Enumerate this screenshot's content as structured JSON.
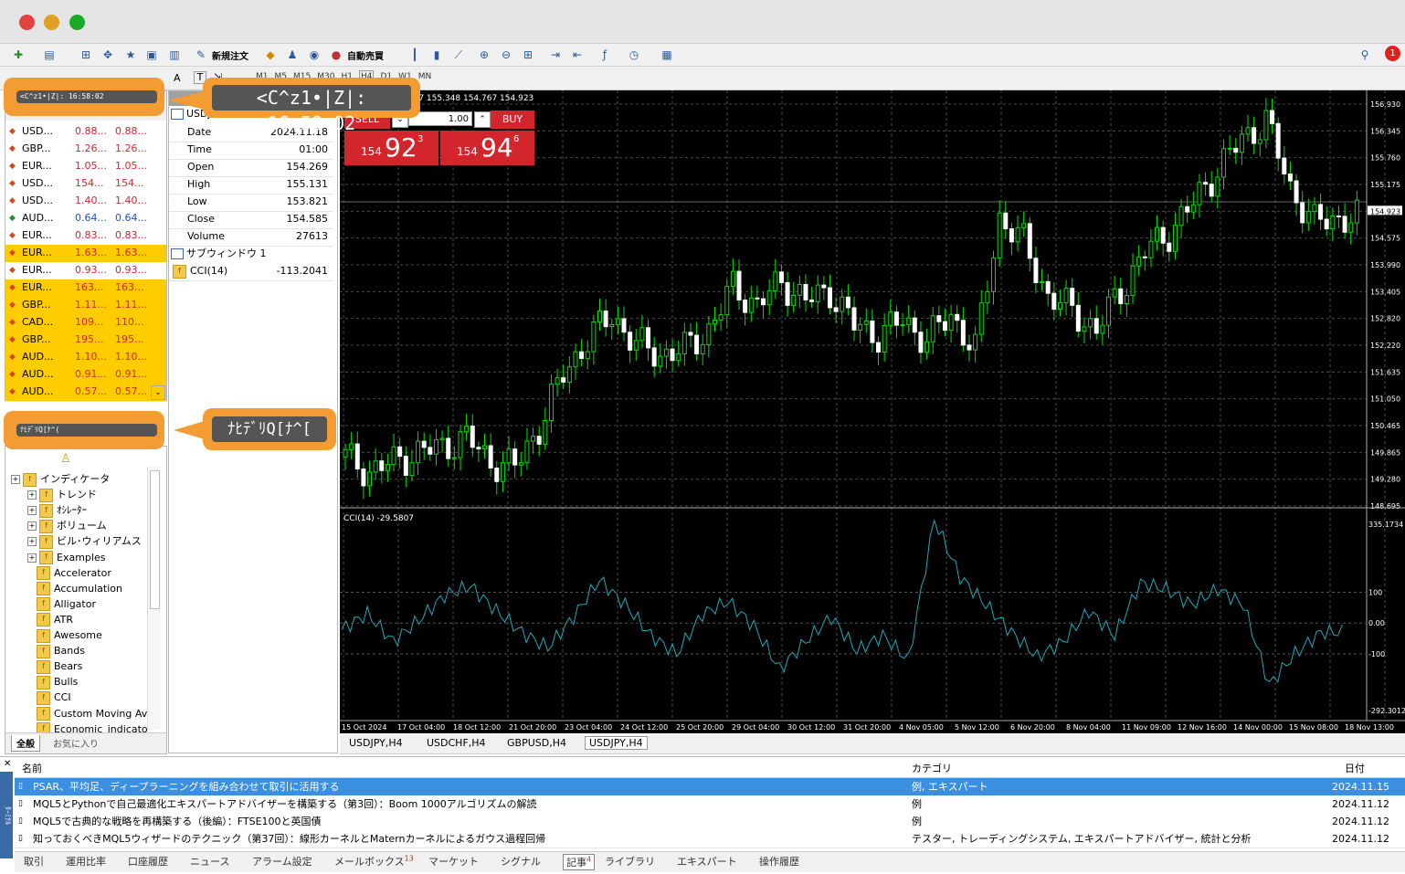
{
  "toolbar": {
    "new_order": "新規注文",
    "auto_trade": "自動売買"
  },
  "timeframes": [
    "M1",
    "M5",
    "M15",
    "M30",
    "H1",
    "H4",
    "D1",
    "W1",
    "MN"
  ],
  "market_watch": {
    "time_label": "<C^z1•|Z|: 16:58:02",
    "rows": [
      {
        "symbol": "USD...",
        "bid": "0.88...",
        "ask": "0.88...",
        "hl": false
      },
      {
        "symbol": "GBP...",
        "bid": "1.26...",
        "ask": "1.26...",
        "hl": false
      },
      {
        "symbol": "EUR...",
        "bid": "1.05...",
        "ask": "1.05...",
        "hl": false
      },
      {
        "symbol": "USD...",
        "bid": "154...",
        "ask": "154...",
        "hl": false
      },
      {
        "symbol": "USD...",
        "bid": "1.40...",
        "ask": "1.40...",
        "hl": false
      },
      {
        "symbol": "AUD...",
        "bid": "0.64...",
        "ask": "0.64...",
        "hl": false,
        "blue": true
      },
      {
        "symbol": "EUR...",
        "bid": "0.83...",
        "ask": "0.83...",
        "hl": false
      },
      {
        "symbol": "EUR...",
        "bid": "1.63...",
        "ask": "1.63...",
        "hl": true
      },
      {
        "symbol": "EUR...",
        "bid": "0.93...",
        "ask": "0.93...",
        "hl": false
      },
      {
        "symbol": "EUR...",
        "bid": "163...",
        "ask": "163...",
        "hl": true
      },
      {
        "symbol": "GBP...",
        "bid": "1.11...",
        "ask": "1.11...",
        "hl": true
      },
      {
        "symbol": "CAD...",
        "bid": "109...",
        "ask": "110...",
        "hl": true
      },
      {
        "symbol": "GBP...",
        "bid": "195...",
        "ask": "195...",
        "hl": true
      },
      {
        "symbol": "AUD...",
        "bid": "1.10...",
        "ask": "1.10...",
        "hl": true
      },
      {
        "symbol": "AUD...",
        "bid": "0.91...",
        "ask": "0.91...",
        "hl": true
      },
      {
        "symbol": "AUD...",
        "bid": "0.57...",
        "ask": "0.57...",
        "hl": true
      }
    ]
  },
  "callouts": {
    "top": "<C^z1•|Z|: 16:58:02",
    "mid": "ﾅﾋﾃﾞﾘQ[ﾅ^["
  },
  "navigator": {
    "title": "ﾅﾋﾃﾞﾘQ[ﾅ^(",
    "items": [
      "インディケータ",
      "トレンド",
      "ｵｼﾚｰﾀｰ",
      "ボリューム",
      "ビル･ウィリアムス",
      "Examples",
      "Accelerator",
      "Accumulation",
      "Alligator",
      "ATR",
      "Awesome",
      "Bands",
      "Bears",
      "Bulls",
      "CCI",
      "Custom Moving Av",
      "Economic_indicato"
    ],
    "tabs": [
      "全般",
      "お気に入り"
    ]
  },
  "data_window": {
    "symbol": "USDJPY,H4",
    "rows": [
      {
        "label": "Date",
        "value": "2024.11.18"
      },
      {
        "label": "Time",
        "value": "01:00"
      },
      {
        "label": "Open",
        "value": "154.269"
      },
      {
        "label": "High",
        "value": "155.131"
      },
      {
        "label": "Low",
        "value": "153.821"
      },
      {
        "label": "Close",
        "value": "154.585"
      },
      {
        "label": "Volume",
        "value": "27613"
      }
    ],
    "subwindow": "サブウィンドウ 1",
    "cci_label": "CCI(14)",
    "cci_value": "-113.2041"
  },
  "chart": {
    "header": "USDJPY,H4  154.767 155.348 154.767 154.923",
    "sell": "SELL",
    "buy": "BUY",
    "lot": "1.00",
    "sell_price": {
      "small": "154",
      "big": "92",
      "sup": "3"
    },
    "buy_price": {
      "small": "154",
      "big": "94",
      "sup": "6"
    },
    "price_labels": [
      "156.930",
      "156.345",
      "155.760",
      "155.175",
      "154.923",
      "154.575",
      "153.990",
      "153.405",
      "152.820",
      "152.220",
      "151.635",
      "151.050",
      "150.465",
      "149.865",
      "149.280",
      "148.695"
    ],
    "cci_header": "CCI(14) -29.5807",
    "cci_labels": [
      "335.1734",
      "100",
      "0.00",
      "-100",
      "-292.3012"
    ],
    "time_labels": [
      "15 Oct 2024",
      "17 Oct 04:00",
      "18 Oct 12:00",
      "21 Oct 20:00",
      "23 Oct 04:00",
      "24 Oct 12:00",
      "25 Oct 20:00",
      "29 Oct 04:00",
      "30 Oct 12:00",
      "31 Oct 20:00",
      "4 Nov 05:00",
      "5 Nov 12:00",
      "6 Nov 20:00",
      "8 Nov 04:00",
      "11 Nov 09:00",
      "12 Nov 16:00",
      "14 Nov 00:00",
      "15 Nov 08:00",
      "18 Nov 13:00"
    ],
    "tabs": [
      "USDJPY,H4",
      "USDCHF,H4",
      "GBPUSD,H4",
      "USDJPY,H4"
    ]
  },
  "chart_data": {
    "type": "line",
    "title": "USDJPY,H4",
    "ylim": [
      148.695,
      156.93
    ],
    "close_approx": [
      149.7,
      149.4,
      149.6,
      149.8,
      149.9,
      150.1,
      149.6,
      149.5,
      150.3,
      151.4,
      152.1,
      152.6,
      152.0,
      151.8,
      151.9,
      152.3,
      153.2,
      152.8,
      153.3,
      152.9,
      153.1,
      152.4,
      152.2,
      152.5,
      152.1,
      152.6,
      151.9,
      154.6,
      154.1,
      153.0,
      152.7,
      152.3,
      153.1,
      153.9,
      154.3,
      154.9,
      155.6,
      156.2,
      156.6,
      155.2,
      154.5,
      154.6
    ],
    "cci_approx": [
      -20,
      30,
      -60,
      10,
      90,
      120,
      40,
      -30,
      -80,
      20,
      140,
      60,
      -40,
      -100,
      30,
      70,
      -10,
      -150,
      -60,
      20,
      -90,
      -40,
      -120,
      335,
      150,
      60,
      -30,
      -110,
      -60,
      40,
      -40,
      130,
      110,
      60,
      110,
      60,
      -200,
      -100,
      -29.58
    ]
  },
  "news": {
    "headers": {
      "name": "名前",
      "category": "カテゴリ",
      "date": "日付"
    },
    "rows": [
      {
        "name": "PSAR、平均足、ディープラーニングを組み合わせて取引に活用する",
        "category": "例, エキスパート",
        "date": "2024.11.15",
        "selected": true
      },
      {
        "name": "MQL5とPythonで自己最適化エキスパートアドバイザーを構築する（第3回）：Boom 1000アルゴリズムの解読",
        "category": "例",
        "date": "2024.11.12"
      },
      {
        "name": "MQL5で古典的な戦略を再構築する（後編）：FTSE100と英国債",
        "category": "例",
        "date": "2024.11.12"
      },
      {
        "name": "知っておくべきMQL5ウィザードのテクニック（第37回）：線形カーネルとMaternカーネルによるガウス過程回帰",
        "category": "テスター, トレーディングシステム, エキスパートアドバイザー, 統計と分析",
        "date": "2024.11.12"
      }
    ],
    "side_label": "ﾀｰﾐﾅﾙ"
  },
  "terminal_tabs": [
    "取引",
    "運用比率",
    "口座履歴",
    "ニュース",
    "アラーム設定",
    "メールボックス",
    "マーケット",
    "シグナル",
    "記事",
    "ライブラリ",
    "エキスパート",
    "操作履歴"
  ],
  "terminal_badges": {
    "mailbox": "13",
    "articles": "4"
  }
}
